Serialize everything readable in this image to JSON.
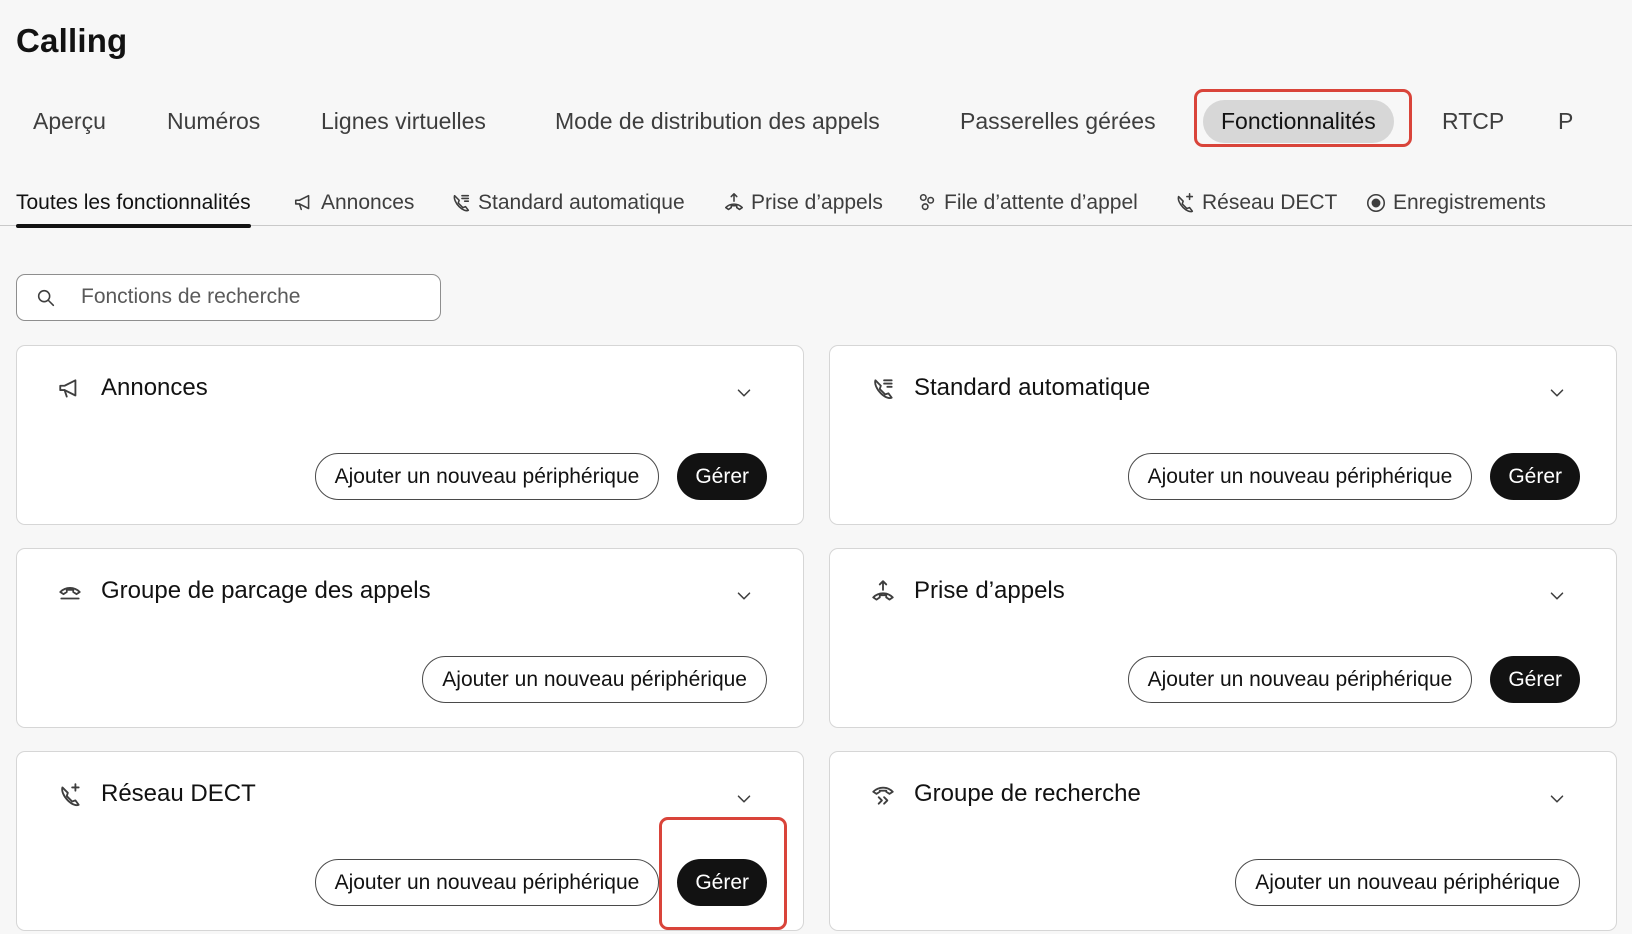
{
  "page_title": "Calling",
  "main_tabs": [
    {
      "label": "Aperçu"
    },
    {
      "label": "Numéros"
    },
    {
      "label": "Lignes virtuelles"
    },
    {
      "label": "Mode de distribution des appels"
    },
    {
      "label": "Passerelles gérées"
    },
    {
      "label": "Fonctionnalités"
    },
    {
      "label": "RTCP"
    },
    {
      "label": "P"
    }
  ],
  "sub_tabs": [
    {
      "label": "Toutes les fonctionnalités",
      "icon": ""
    },
    {
      "label": "Annonces",
      "icon": "megaphone-icon"
    },
    {
      "label": "Standard automatique",
      "icon": "auto-attendant-icon"
    },
    {
      "label": "Prise d’appels",
      "icon": "call-pickup-icon"
    },
    {
      "label": "File d’attente d’appel",
      "icon": "call-queue-icon"
    },
    {
      "label": "Réseau DECT",
      "icon": "dect-network-icon"
    },
    {
      "label": "Enregistrements",
      "icon": "record-icon"
    }
  ],
  "search": {
    "placeholder": "Fonctions de recherche",
    "value": ""
  },
  "cards": [
    {
      "title": "Annonces",
      "icon": "megaphone-icon",
      "add_label": "Ajouter un nouveau périphérique",
      "manage_label": "Gérer"
    },
    {
      "title": "Standard automatique",
      "icon": "auto-attendant-icon",
      "add_label": "Ajouter un nouveau périphérique",
      "manage_label": "Gérer"
    },
    {
      "title": "Groupe de parcage des appels",
      "icon": "call-park-icon",
      "add_label": "Ajouter un nouveau périphérique"
    },
    {
      "title": "Prise d’appels",
      "icon": "call-pickup-icon",
      "add_label": "Ajouter un nouveau périphérique",
      "manage_label": "Gérer"
    },
    {
      "title": "Réseau DECT",
      "icon": "dect-network-icon",
      "add_label": "Ajouter un nouveau périphérique",
      "manage_label": "Gérer"
    },
    {
      "title": "Groupe de recherche",
      "icon": "hunt-group-icon",
      "add_label": "Ajouter un nouveau périphérique"
    }
  ],
  "colors": {
    "highlight": "#d9443a",
    "primary_button": "#121212",
    "active_pill": "#d7d7d7"
  }
}
